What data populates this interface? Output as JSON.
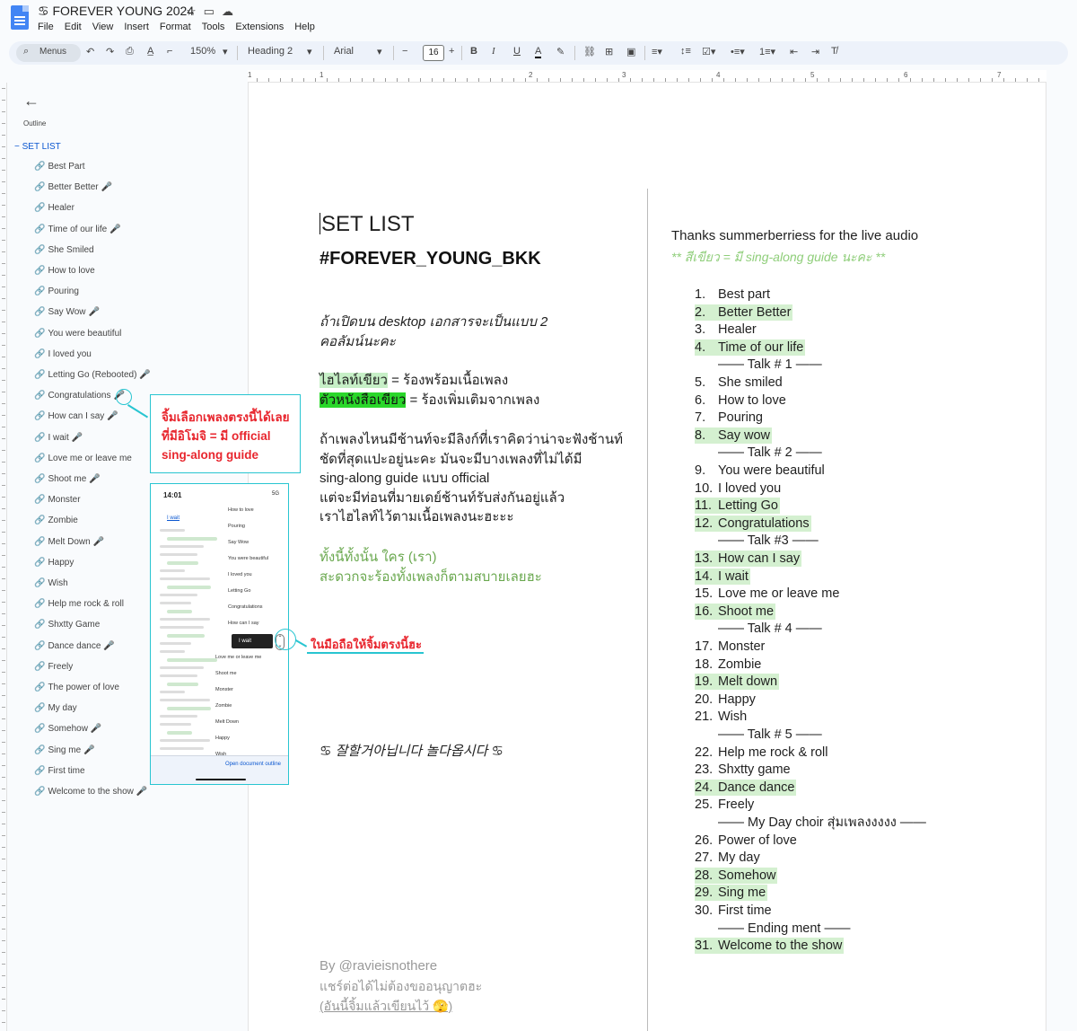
{
  "app": {
    "doc_title": "♋ FOREVER YOUNG 2024",
    "menus": [
      "File",
      "Edit",
      "View",
      "Insert",
      "Format",
      "Tools",
      "Extensions",
      "Help"
    ]
  },
  "toolbar": {
    "search_label": "Menus",
    "zoom": "150%",
    "style": "Heading 2",
    "font": "Arial",
    "font_size": "16"
  },
  "ruler": {
    "marks": [
      "1",
      "1",
      "2",
      "3",
      "4",
      "5",
      "6",
      "7"
    ]
  },
  "sidebar": {
    "outline_label": "Outline",
    "heading": "SET LIST",
    "items": [
      {
        "label": "Best Part",
        "mic": false
      },
      {
        "label": "Better Better",
        "mic": true
      },
      {
        "label": "Healer",
        "mic": false
      },
      {
        "label": "Time of our life",
        "mic": true
      },
      {
        "label": "She Smiled",
        "mic": false
      },
      {
        "label": "How to love",
        "mic": false
      },
      {
        "label": "Pouring",
        "mic": false
      },
      {
        "label": "Say Wow",
        "mic": true
      },
      {
        "label": "You were beautiful",
        "mic": false
      },
      {
        "label": "I loved you",
        "mic": false
      },
      {
        "label": "Letting Go (Rebooted)",
        "mic": true
      },
      {
        "label": "Congratulations",
        "mic": true
      },
      {
        "label": "How can I say",
        "mic": true
      },
      {
        "label": "I wait",
        "mic": true
      },
      {
        "label": "Love me or leave me",
        "mic": false
      },
      {
        "label": "Shoot me",
        "mic": true
      },
      {
        "label": "Monster",
        "mic": false
      },
      {
        "label": "Zombie",
        "mic": false
      },
      {
        "label": "Melt Down",
        "mic": true
      },
      {
        "label": "Happy",
        "mic": false
      },
      {
        "label": "Wish",
        "mic": false
      },
      {
        "label": "Help me rock & roll",
        "mic": false
      },
      {
        "label": "Shxtty Game",
        "mic": false
      },
      {
        "label": "Dance dance",
        "mic": true
      },
      {
        "label": "Freely",
        "mic": false
      },
      {
        "label": "The power of love",
        "mic": false
      },
      {
        "label": "My day",
        "mic": false
      },
      {
        "label": "Somehow",
        "mic": true
      },
      {
        "label": "Sing me",
        "mic": true
      },
      {
        "label": "First time",
        "mic": false
      },
      {
        "label": "Welcome to the show",
        "mic": true
      }
    ]
  },
  "annotations": {
    "box_lines": [
      "จิ้มเลือกเพลงตรงนี้ได้เลย",
      "ที่มีอิโมจิ = มี official",
      "sing-along guide"
    ],
    "phone_note": "ในมือถือให้จิ้มตรงนี้ฮะ"
  },
  "phone": {
    "time": "14:01",
    "status": "5G",
    "i_wait": "I wait",
    "items": [
      "How to love",
      "Pouring",
      "Say Wow",
      "You were beautiful",
      "I loved you",
      "Letting Go",
      "Congratulations",
      "How can I say",
      "Love me or leave me",
      "Shoot me",
      "Monster",
      "Zombie",
      "Melt Down",
      "Happy",
      "Wish"
    ],
    "popup": "I wait",
    "open_outline": "Open document outline"
  },
  "doc": {
    "title": "SET LIST",
    "hashtag": "#FOREVER_YOUNG_BKK",
    "desktop_note": [
      "ถ้าเปิดบน desktop เอกสารจะเป็นแบบ 2",
      "คอลัมน์นะคะ"
    ],
    "hl_green_label": "ไฮไลท์เขียว",
    "hl_green_desc": " = ร้องพร้อมเนื้อเพลง",
    "text_green_label": "ตัวหนังสือเขียว",
    "text_green_desc": " = ร้องเพิ่มเติมจากเพลง",
    "para": [
      "ถ้าเพลงไหนมีช้านท์จะมีลิงก์ที่เราคิดว่าน่าจะฟังช้านท์",
      "ชัดที่สุดแปะอยู่นะคะ มันจะมีบางเพลงที่ไม่ได้มี",
      "sing-along guide แบบ official",
      "แต่จะมีท่อนที่มายเดย์ช้านท์รับส่งกันอยู่แล้ว",
      "เราไฮไลท์ไว้ตามเนื้อเพลงนะฮะะะ"
    ],
    "green_para": [
      "ทั้งนี้ทั้งนั้น ใคร (เรา)",
      "สะดวกจะร้องทั้งเพลงก็ตามสบายเลยฮะ"
    ],
    "korean": "♋ 잘할거아닙니다 놀다옵시다 ♋",
    "by": "By @ravieisnothere",
    "share": "แชร์ต่อได้ไม่ต้องขออนุญาตฮะ",
    "share2": "(อันนี้จิ้มแล้วเขียนไว้ 🫣)"
  },
  "right_col": {
    "thanks": "Thanks summerberriess for the live audio",
    "legend": "** สีเขียว = มี sing-along guide นะคะ **",
    "lines": [
      {
        "type": "song",
        "n": "1.",
        "t": "Best part",
        "hl": false
      },
      {
        "type": "song",
        "n": "2.",
        "t": "Better Better",
        "hl": true
      },
      {
        "type": "song",
        "n": "3.",
        "t": "Healer",
        "hl": false
      },
      {
        "type": "song",
        "n": "4.",
        "t": "Time of our life",
        "hl": true
      },
      {
        "type": "talk",
        "t": "—— Talk # 1 ——"
      },
      {
        "type": "song",
        "n": "5.",
        "t": "She smiled",
        "hl": false
      },
      {
        "type": "song",
        "n": "6.",
        "t": "How to love",
        "hl": false
      },
      {
        "type": "song",
        "n": "7.",
        "t": "Pouring",
        "hl": false
      },
      {
        "type": "song",
        "n": "8.",
        "t": "Say wow",
        "hl": true
      },
      {
        "type": "talk",
        "t": "—— Talk # 2 ——"
      },
      {
        "type": "song",
        "n": "9.",
        "t": "You were beautiful",
        "hl": false
      },
      {
        "type": "song",
        "n": "10.",
        "t": "I loved you",
        "hl": false
      },
      {
        "type": "song",
        "n": "11.",
        "t": "Letting Go",
        "hl": true
      },
      {
        "type": "song",
        "n": "12.",
        "t": "Congratulations",
        "hl": true
      },
      {
        "type": "talk",
        "t": "—— Talk  #3 ——"
      },
      {
        "type": "song",
        "n": "13.",
        "t": "How can I say",
        "hl": true
      },
      {
        "type": "song",
        "n": "14.",
        "t": "I wait",
        "hl": true
      },
      {
        "type": "song",
        "n": "15.",
        "t": "Love me or leave me",
        "hl": false
      },
      {
        "type": "song",
        "n": "16.",
        "t": "Shoot me",
        "hl": true
      },
      {
        "type": "talk",
        "t": "—— Talk # 4 ——"
      },
      {
        "type": "song",
        "n": "17.",
        "t": "Monster",
        "hl": false
      },
      {
        "type": "song",
        "n": "18.",
        "t": "Zombie",
        "hl": false
      },
      {
        "type": "song",
        "n": "19.",
        "t": "Melt down",
        "hl": true
      },
      {
        "type": "song",
        "n": "20.",
        "t": "Happy",
        "hl": false
      },
      {
        "type": "song",
        "n": "21.",
        "t": "Wish",
        "hl": false
      },
      {
        "type": "talk",
        "t": "—— Talk # 5 ——"
      },
      {
        "type": "song",
        "n": "22.",
        "t": "Help me rock & roll",
        "hl": false
      },
      {
        "type": "song",
        "n": "23.",
        "t": "Shxtty game",
        "hl": false
      },
      {
        "type": "song",
        "n": "24.",
        "t": "Dance dance",
        "hl": true
      },
      {
        "type": "song",
        "n": "25.",
        "t": "Freely",
        "hl": false
      },
      {
        "type": "talk",
        "t": "—— My Day choir สุ่มเพลงงงงง ——"
      },
      {
        "type": "song",
        "n": "26.",
        "t": "Power of love",
        "hl": false
      },
      {
        "type": "song",
        "n": "27.",
        "t": "My day",
        "hl": false
      },
      {
        "type": "song",
        "n": "28.",
        "t": "Somehow",
        "hl": true
      },
      {
        "type": "song",
        "n": "29.",
        "t": "Sing me",
        "hl": true
      },
      {
        "type": "song",
        "n": "30.",
        "t": "First time",
        "hl": false
      },
      {
        "type": "talk",
        "t": "—— Ending ment ——"
      },
      {
        "type": "song",
        "n": "31.",
        "t": "Welcome to the show",
        "hl": true
      }
    ]
  },
  "colors": {
    "accent": "#0b57d0",
    "annot_cyan": "#28c5d1",
    "annot_red": "#e8262e",
    "highlight": "#c6efc6"
  }
}
